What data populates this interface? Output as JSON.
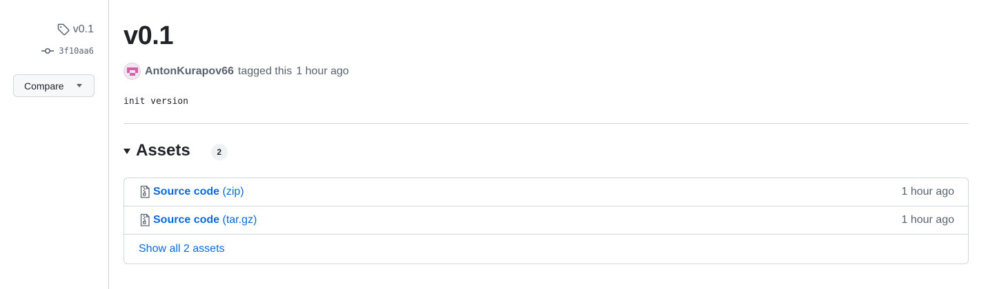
{
  "sidebar": {
    "tag": "v0.1",
    "commit": "3f10aa6",
    "compare_label": "Compare"
  },
  "release": {
    "title": "v0.1",
    "author": "AntonKurapov66",
    "tagged_text": "tagged this",
    "time": "1 hour ago",
    "notes": "init version"
  },
  "assets": {
    "heading": "Assets",
    "count": "2",
    "items": [
      {
        "name_bold": "Source code",
        "format": "(zip)",
        "time": "1 hour ago"
      },
      {
        "name_bold": "Source code",
        "format": "(tar.gz)",
        "time": "1 hour ago"
      }
    ],
    "show_all_label": "Show all 2 assets"
  },
  "colors": {
    "link": "#0969da",
    "muted": "#59636e",
    "border": "#d0d7de"
  }
}
